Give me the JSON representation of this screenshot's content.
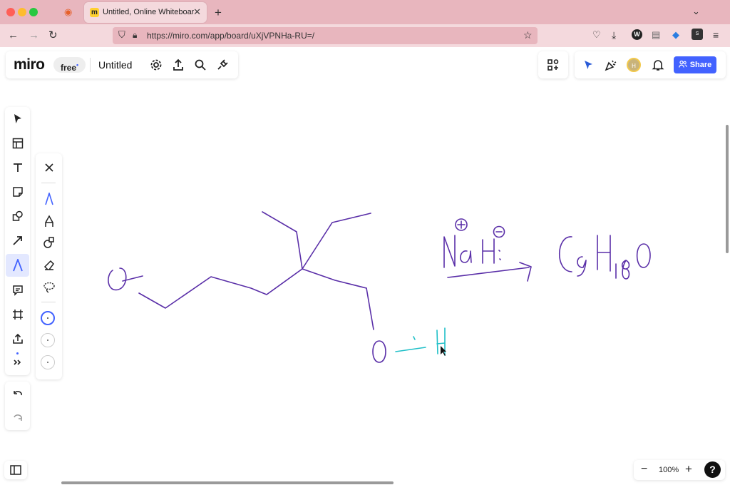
{
  "browser": {
    "tab_title": "Untitled, Online Whiteboard for",
    "url": "https://miro.com/app/board/uXjVPNHa-RU=/",
    "new_tab": "+",
    "tab_close": "✕"
  },
  "header": {
    "logo": "miro",
    "plan_badge": "free",
    "plan_badge_mark": "•",
    "board_title": "Untitled",
    "share_label": "Share",
    "avatar_initial": "H"
  },
  "zoom": {
    "value": "100%",
    "minus": "−",
    "plus": "+"
  },
  "help": "?",
  "colors": {
    "tab_bar": "#e8b6be",
    "nav_bar": "#f4d9dd",
    "accent": "#4262ff",
    "ink_purple": "#5a2fa8",
    "ink_teal": "#21c0c8"
  },
  "drawing": {
    "reagent_left": "Na",
    "reagent_right": "H",
    "charge_plus": "+",
    "charge_minus": "−",
    "product_c": "C",
    "product_sub1": "9",
    "product_h": "H",
    "product_sub2": "18",
    "product_o": "O",
    "oxygen_left": "O",
    "oxygen_bottom": "O",
    "hydrogen_bottom": "H"
  }
}
